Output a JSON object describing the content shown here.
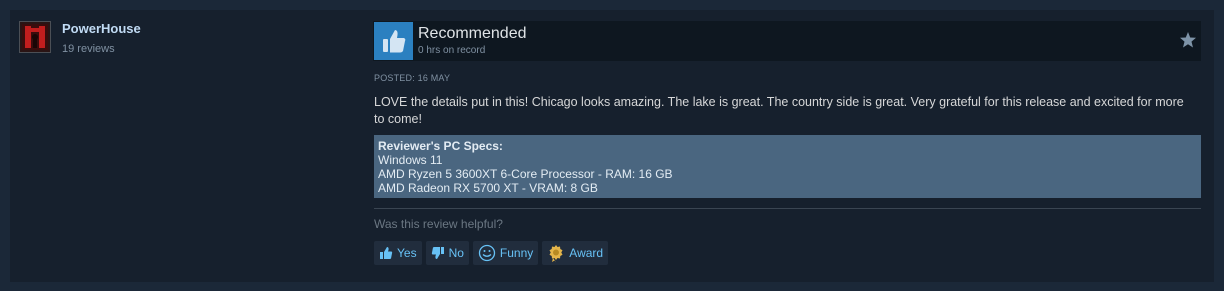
{
  "author": {
    "name": "PowerHouse",
    "reviews": "19 reviews",
    "avatar_icon": "red-figure-avatar"
  },
  "review": {
    "verdict": "Recommended",
    "verdict_icon": "thumbs-up-icon",
    "hours": "0 hrs on record",
    "posted": "POSTED: 16 MAY",
    "text": "LOVE the details put in this! Chicago looks amazing. The lake is great. The country side is great. Very grateful for this release and excited for more to come!",
    "specs": {
      "title": "Reviewer's PC Specs:",
      "lines": [
        "Windows 11",
        "AMD Ryzen 5 3600XT 6-Core Processor - RAM: 16 GB",
        "AMD Radeon RX 5700 XT - VRAM: 8 GB"
      ]
    }
  },
  "helpful": {
    "prompt": "Was this review helpful?",
    "yes": "Yes",
    "no": "No",
    "funny": "Funny",
    "award": "Award"
  },
  "colors": {
    "background": "#1b2838",
    "card": "#16202d",
    "accent_blue": "#2b80c0",
    "link": "#67c1f5",
    "specs_bg": "#4a6680"
  }
}
